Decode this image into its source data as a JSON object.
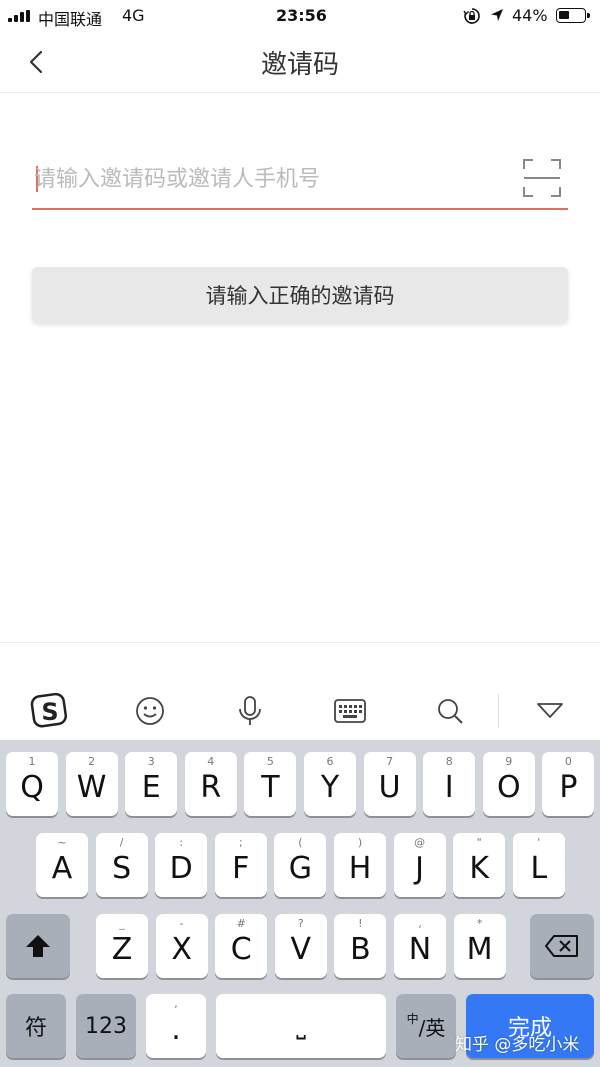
{
  "status_bar": {
    "carrier": "中国联通",
    "network": "4G",
    "time": "23:56",
    "battery_percent": "44%",
    "battery_level": 0.44,
    "icons": [
      "signal-icon",
      "orientation-lock-icon",
      "location-arrow-icon",
      "battery-icon"
    ]
  },
  "nav": {
    "title": "邀请码",
    "back_icon": "chevron-left-icon"
  },
  "form": {
    "input_placeholder": "请输入邀请码或邀请人手机号",
    "input_value": "",
    "scan_icon": "scan-frame-icon",
    "submit_label": "请输入正确的邀请码",
    "accent_color": "#e0705e"
  },
  "keyboard_toolbar": {
    "icons": [
      "sogou-logo-icon",
      "emoji-icon",
      "microphone-icon",
      "keyboard-icon",
      "search-icon",
      "collapse-triangle-icon"
    ]
  },
  "keyboard": {
    "row1": [
      {
        "key": "Q",
        "hint": "1"
      },
      {
        "key": "W",
        "hint": "2"
      },
      {
        "key": "E",
        "hint": "3"
      },
      {
        "key": "R",
        "hint": "4"
      },
      {
        "key": "T",
        "hint": "5"
      },
      {
        "key": "Y",
        "hint": "6"
      },
      {
        "key": "U",
        "hint": "7"
      },
      {
        "key": "I",
        "hint": "8"
      },
      {
        "key": "O",
        "hint": "9"
      },
      {
        "key": "P",
        "hint": "0"
      }
    ],
    "row2": [
      {
        "key": "A",
        "hint": "~"
      },
      {
        "key": "S",
        "hint": "/"
      },
      {
        "key": "D",
        "hint": ":"
      },
      {
        "key": "F",
        "hint": ";"
      },
      {
        "key": "G",
        "hint": "("
      },
      {
        "key": "H",
        "hint": ")"
      },
      {
        "key": "J",
        "hint": "@"
      },
      {
        "key": "K",
        "hint": "\""
      },
      {
        "key": "L",
        "hint": "'"
      }
    ],
    "row3": [
      {
        "key": "Z",
        "hint": "_"
      },
      {
        "key": "X",
        "hint": "-"
      },
      {
        "key": "C",
        "hint": "#"
      },
      {
        "key": "V",
        "hint": "?"
      },
      {
        "key": "B",
        "hint": "!"
      },
      {
        "key": "N",
        "hint": ","
      },
      {
        "key": "M",
        "hint": "*"
      }
    ],
    "shift_icon": "shift-arrow-icon",
    "backspace_icon": "backspace-icon",
    "symbol_key": "符",
    "numbers_key": "123",
    "punct_key": ".",
    "punct_hint": ",",
    "space_key": "⎵",
    "lang_key_small": "中",
    "lang_key": "/英",
    "done_key": "完成",
    "done_color": "#3478f6"
  },
  "watermark": "知乎 @多吃小米"
}
